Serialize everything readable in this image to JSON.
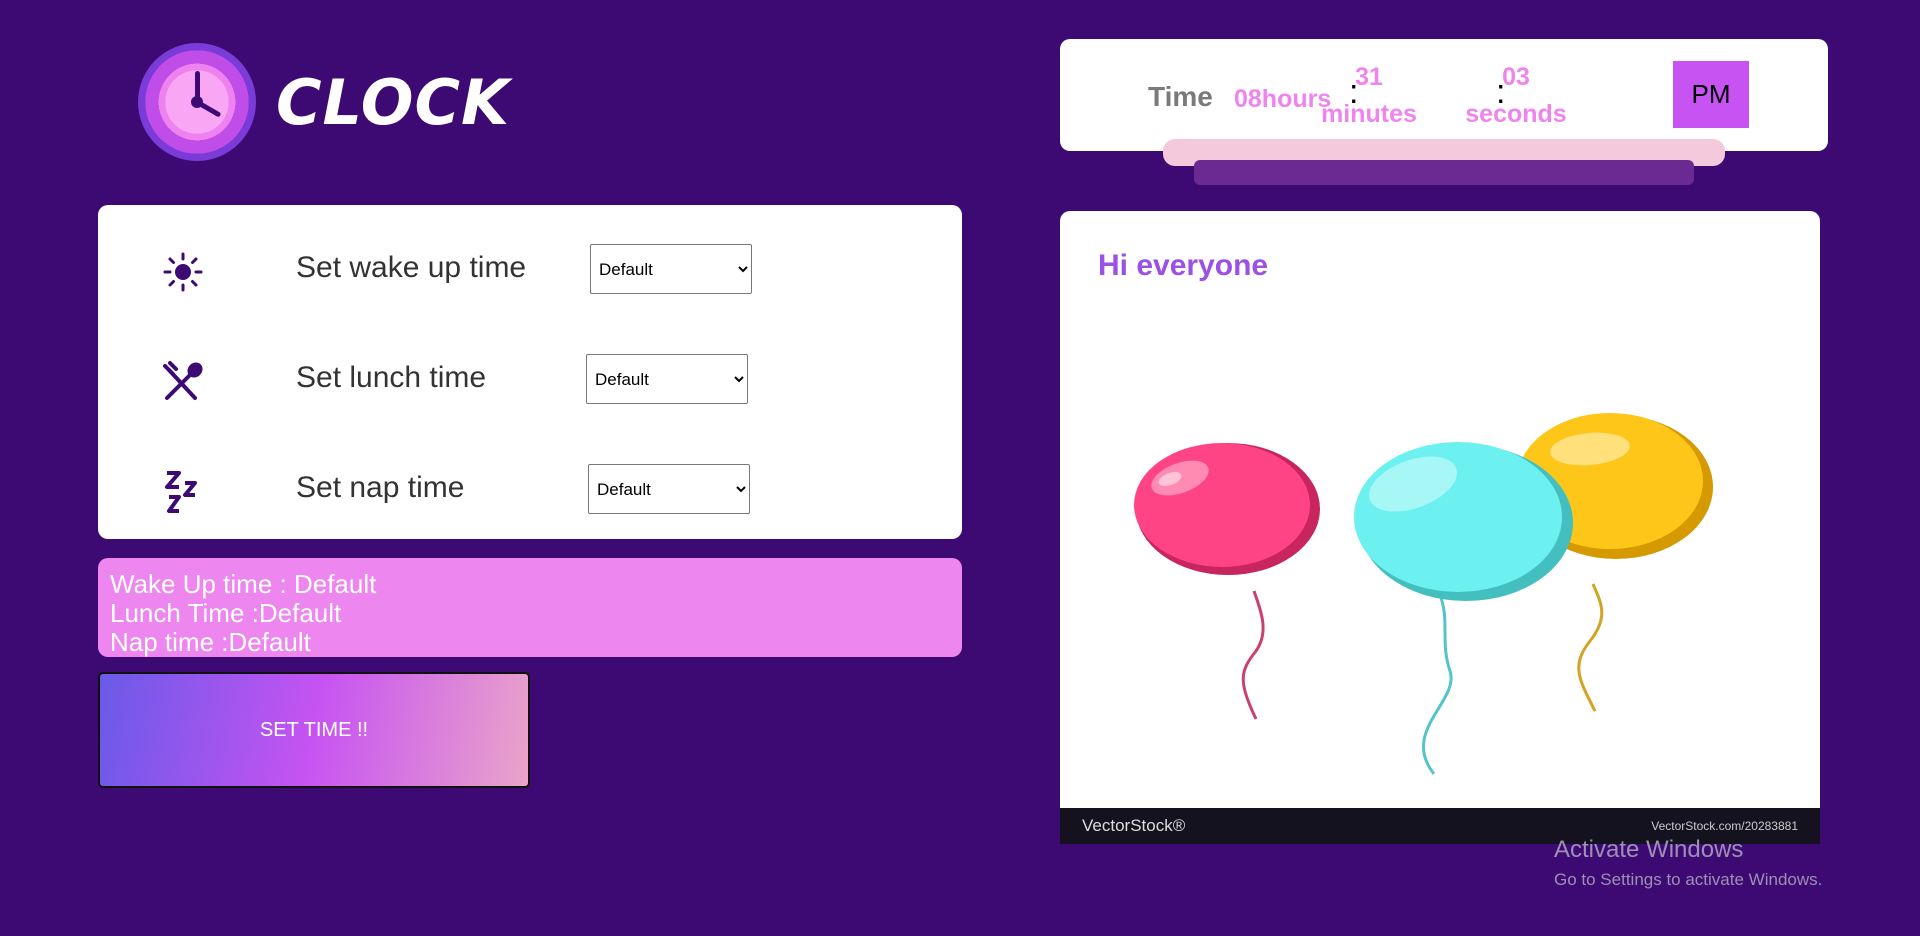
{
  "logo": {
    "text": "CLOCK"
  },
  "settings": [
    {
      "icon": "sun-icon",
      "label": "Set wake up time",
      "selected": "Default"
    },
    {
      "icon": "fork-spoon-icon",
      "label": "Set lunch time",
      "selected": "Default"
    },
    {
      "icon": "zzz-icon",
      "label": "Set nap time",
      "selected": "Default"
    }
  ],
  "summary": {
    "wake": "Wake Up time : Default",
    "lunch": "Lunch Time :Default",
    "nap": "Nap time :Default"
  },
  "button": {
    "label": "SET TIME !!"
  },
  "time": {
    "label": "Time",
    "hours": "08hours",
    "minutes_value": "31",
    "minutes_label": "minutes",
    "seconds_value": "03",
    "seconds_label": "seconds",
    "separator": ":",
    "ampm": "PM"
  },
  "greeting": {
    "text": "Hi everyone",
    "stock_brand": "VectorStock®",
    "stock_id": "VectorStock.com/20283881"
  },
  "watermark": {
    "line1": "Activate Windows",
    "line2": "Go to Settings to activate Windows."
  },
  "colors": {
    "background": "#3d0a73",
    "accent_pink": "#ed86ef",
    "accent_purple": "#c653f2"
  }
}
